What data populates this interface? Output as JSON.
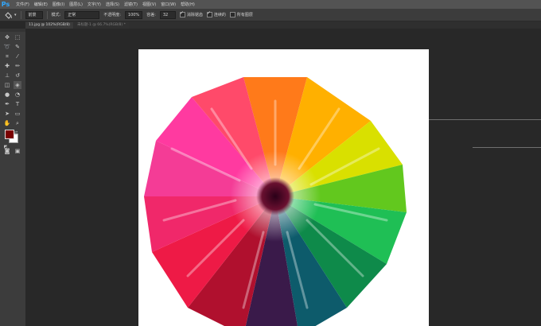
{
  "menu": {
    "logo": "Ps",
    "items": [
      "文件(F)",
      "编辑(E)",
      "图像(I)",
      "图层(L)",
      "文字(Y)",
      "选择(S)",
      "滤镜(T)",
      "视图(V)",
      "窗口(W)",
      "帮助(H)"
    ]
  },
  "options": {
    "brush_preset": "前景",
    "mode_label": "模式:",
    "mode_value": "正常",
    "opacity_label": "不透明度:",
    "opacity_value": "100%",
    "tolerance_label": "容差:",
    "tolerance_value": "32",
    "antialias_label": "消除锯齿",
    "contiguous_label": "连续的",
    "all_layers_label": "所有图层"
  },
  "tabs": {
    "active": "11.jpg @ 102%(RGB/8)",
    "inactive": "未标题-1 @ 66.7%(RGB/8) *"
  },
  "colors": {
    "foreground": "#7a0000",
    "background": "#ffffff"
  }
}
